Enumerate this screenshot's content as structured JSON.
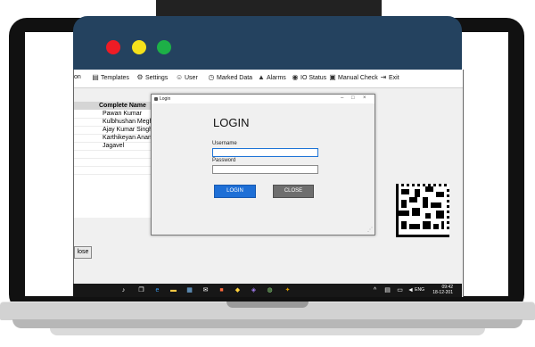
{
  "menu": {
    "items": [
      {
        "label": "on",
        "icon": "none"
      },
      {
        "label": "Templates",
        "icon": "document-icon"
      },
      {
        "label": "Settings",
        "icon": "gear-icon"
      },
      {
        "label": "User",
        "icon": "user-icon"
      },
      {
        "label": "Marked Data",
        "icon": "clock-refresh-icon"
      },
      {
        "label": "Alarms",
        "icon": "bell-icon"
      },
      {
        "label": "IO Status",
        "icon": "eye-icon"
      },
      {
        "label": "Manual Check",
        "icon": "clipboard-icon"
      },
      {
        "label": "Exit",
        "icon": "exit-icon"
      }
    ]
  },
  "table": {
    "header": "Complete Name",
    "rows": [
      "Pawan Kumar",
      "Kulbhushan Meghal",
      "Ajay Kumar Singh",
      "Karthikeyan Anandra",
      "Jagavel"
    ]
  },
  "background_close": "lose",
  "dialog": {
    "title": "Login",
    "heading": "LOGIN",
    "username_label": "Username",
    "username_value": "",
    "password_label": "Password",
    "password_value": "",
    "login_button": "LOGIN",
    "close_button": "CLOSE"
  },
  "taskbar": {
    "language": "ENG",
    "time": "09:42",
    "date": "18-12-201"
  },
  "colors": {
    "window_header": "#24425f",
    "dot_red": "#ee1c25",
    "dot_yellow": "#f5e11b",
    "dot_green": "#1db047",
    "login_button": "#1e6fd6",
    "close_button": "#6e6e6e"
  }
}
